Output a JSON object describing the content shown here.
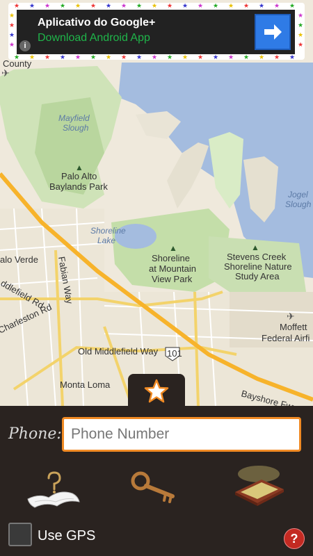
{
  "ad": {
    "title": "Aplicativo do Google+",
    "subtitle": "Download Android App",
    "info_glyph": "i"
  },
  "map": {
    "labels": {
      "county": "County",
      "mayfield_1": "Mayfield",
      "mayfield_2": "Slough",
      "palo_alto_1": "Palo Alto",
      "palo_alto_2": "Baylands Park",
      "shoreline_lake_1": "Shoreline",
      "shoreline_lake_2": "Lake",
      "shoreline_park_1": "Shoreline",
      "shoreline_park_2": "at Mountain",
      "shoreline_park_3": "View Park",
      "stevens_1": "Stevens Creek",
      "stevens_2": "Shoreline Nature",
      "stevens_3": "Study Area",
      "jogel_1": "Jogel",
      "jogel_2": "Slough",
      "moffett_1": "Moffett",
      "moffett_2": "Federal Airfi",
      "palo_verde": "alo Verde",
      "fabian": "Fabian Way",
      "middlefield_rd": "ddlefield Rd",
      "charleston": "Charleston Rd",
      "old_middlefield": "Old Middlefield Way",
      "route_101": "101",
      "monta_loma": "Monta Loma",
      "bayshore": "Bayshore Fwy"
    }
  },
  "phone": {
    "label": "Phone:",
    "placeholder": "Phone Number"
  },
  "gps": {
    "label": "Use GPS",
    "checked": false
  },
  "help": {
    "glyph": "?"
  },
  "icons": {
    "tab": "star-icon",
    "tool1": "treasure-map-icon",
    "tool2": "key-icon",
    "tool3": "lockbox-icon",
    "ad": "arrow-right-icon"
  },
  "colors": {
    "panel": "#2a2320",
    "accent": "#f08a24",
    "ad_green": "#1fb54a",
    "ad_button": "#2f7be6",
    "help": "#c42a22"
  }
}
